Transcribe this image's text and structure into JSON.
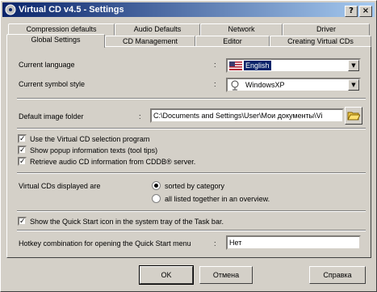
{
  "window": {
    "title": "Virtual CD v4.5 - Settings",
    "help_glyph": "?",
    "close_glyph": "×"
  },
  "tabs": {
    "row1": [
      "Compression defaults",
      "Audio Defaults",
      "Network",
      "Driver"
    ],
    "row2": [
      "Global Settings",
      "CD Management",
      "Editor",
      "Creating Virtual CDs"
    ],
    "active": "Global Settings"
  },
  "global": {
    "language_label": "Current language",
    "language_value": "English",
    "symbol_style_label": "Current symbol style",
    "symbol_style_value": "WindowsXP",
    "image_folder_label": "Default image folder",
    "image_folder_value": "C:\\Documents and Settings\\User\\Мои документы\\Vi",
    "colon": ":",
    "checks": [
      {
        "label": "Use the Virtual CD selection program",
        "checked": true
      },
      {
        "label": "Show popup information texts (tool tips)",
        "checked": true
      },
      {
        "label": "Retrieve audio CD information from CDDB® server.",
        "checked": true
      }
    ],
    "display_label": "Virtual CDs displayed are",
    "display_options": [
      {
        "label": "sorted by category",
        "selected": true
      },
      {
        "label": "all listed together in an overview.",
        "selected": false
      }
    ],
    "quickstart_check": {
      "label": "Show the Quick Start icon in the system tray of the Task bar.",
      "checked": true
    },
    "hotkey_label": "Hotkey combination for opening the Quick Start menu",
    "hotkey_value": "Нет"
  },
  "buttons": {
    "ok": "OK",
    "cancel": "Отмена",
    "help": "Справка"
  },
  "check_glyph": "✓"
}
